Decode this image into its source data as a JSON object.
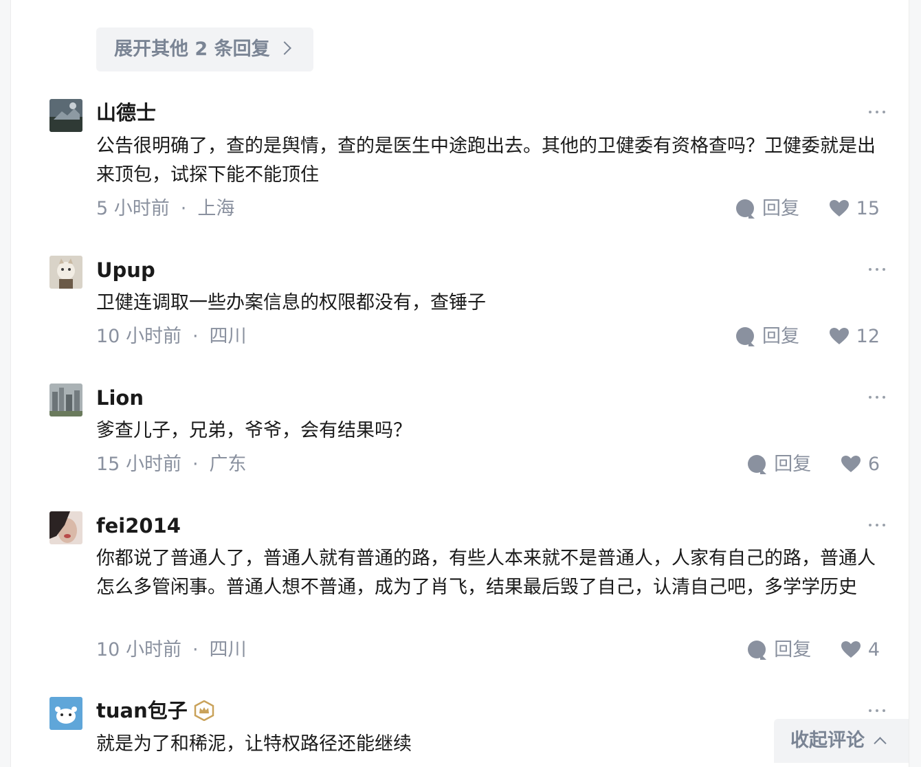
{
  "expand_replies": {
    "label": "展开其他 2 条回复"
  },
  "comments": [
    {
      "user": "山德士",
      "text": "公告很明确了，查的是舆情，查的是医生中途跑出去。其他的卫健委有资格查吗？卫健委就是出来顶包，试探下能不能顶住",
      "time": "5 小时前",
      "location": "上海",
      "reply_label": "回复",
      "likes": "15"
    },
    {
      "user": "Upup",
      "text": "卫健连调取一些办案信息的权限都没有，查锤子",
      "time": "10 小时前",
      "location": "四川",
      "reply_label": "回复",
      "likes": "12"
    },
    {
      "user": "Lion",
      "text": "爹查儿子，兄弟，爷爷，会有结果吗？",
      "time": "15 小时前",
      "location": "广东",
      "reply_label": "回复",
      "likes": "6"
    },
    {
      "user": "fei2014",
      "text": "你都说了普通人了，普通人就有普通的路，有些人本来就不是普通人，人家有自己的路，普通人怎么多管闲事。普通人想不普通，成为了肖飞，结果最后毁了自己，认清自己吧，多学学历史",
      "time": "10 小时前",
      "location": "四川",
      "reply_label": "回复",
      "likes": "4"
    },
    {
      "user": "tuan包子",
      "text": "就是为了和稀泥，让特权路径还能继续"
    }
  ],
  "meta_separator": "·",
  "collapse_comments": {
    "label": "收起评论"
  },
  "icons": {
    "reply": "comment-bubble-icon",
    "like": "heart-icon",
    "more": "more-dots-icon",
    "badge": "crown-badge-icon"
  },
  "colors": {
    "muted_text": "#8a919f",
    "primary_text": "#1a1a1a",
    "button_bg": "#f2f3f5",
    "badge": "#c9a25a"
  }
}
